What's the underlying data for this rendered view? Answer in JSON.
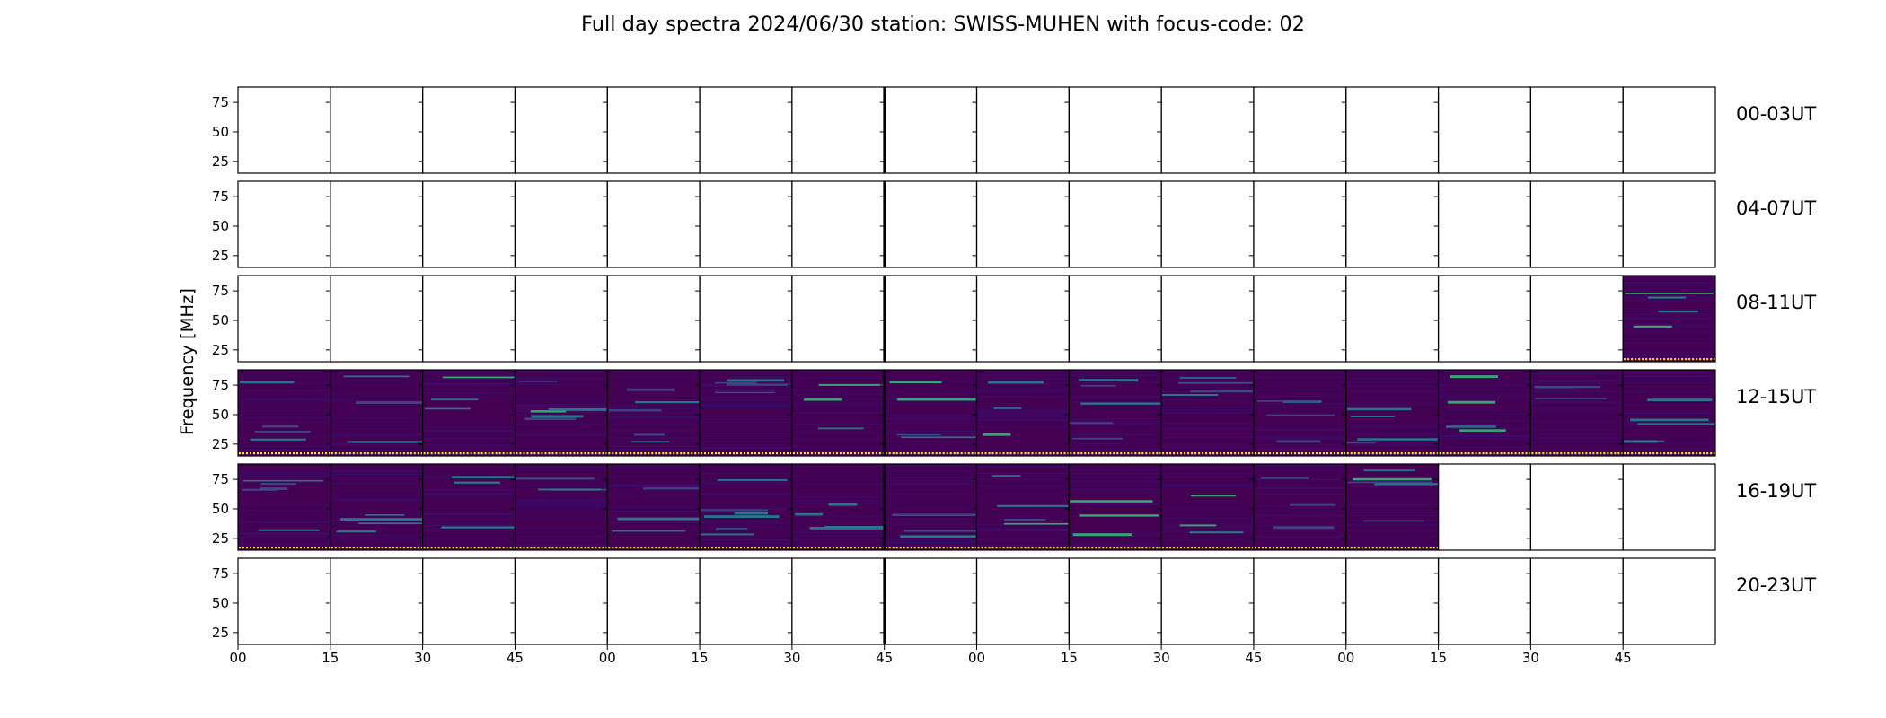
{
  "chart_data": {
    "type": "heatmap",
    "title": "Full day spectra 2024/06/30 station: SWISS-MUHEN with focus-code: 02",
    "ylabel": "Frequency [MHz]",
    "xlabel": "",
    "y_ticks": [
      25,
      50,
      75
    ],
    "y_range": [
      15,
      88
    ],
    "x_ticks": [
      "00",
      "15",
      "30",
      "45",
      "00",
      "15",
      "30",
      "45",
      "00",
      "15",
      "30",
      "45",
      "00",
      "15",
      "30",
      "45"
    ],
    "segments_per_row": 16,
    "segment_minutes": 15,
    "colormap": "viridis",
    "rows": [
      {
        "label": "00-03UT",
        "data_segments": []
      },
      {
        "label": "04-07UT",
        "data_segments": []
      },
      {
        "label": "08-11UT",
        "data_segments": [
          15
        ]
      },
      {
        "label": "12-15UT",
        "data_segments": [
          0,
          1,
          2,
          3,
          4,
          5,
          6,
          7,
          8,
          9,
          10,
          11,
          12,
          13,
          14,
          15
        ]
      },
      {
        "label": "16-19UT",
        "data_segments": [
          0,
          1,
          2,
          3,
          4,
          5,
          6,
          7,
          8,
          9,
          10,
          11,
          12
        ]
      },
      {
        "label": "20-23UT",
        "data_segments": []
      }
    ],
    "colors": {
      "background": "#440154",
      "stripe_dark": "#3b0f70",
      "band_mid": "#3e4a89",
      "band_teal": "#26828e",
      "band_green": "#35b779",
      "band_yellow": "#fde725",
      "axes": "#000000"
    }
  }
}
